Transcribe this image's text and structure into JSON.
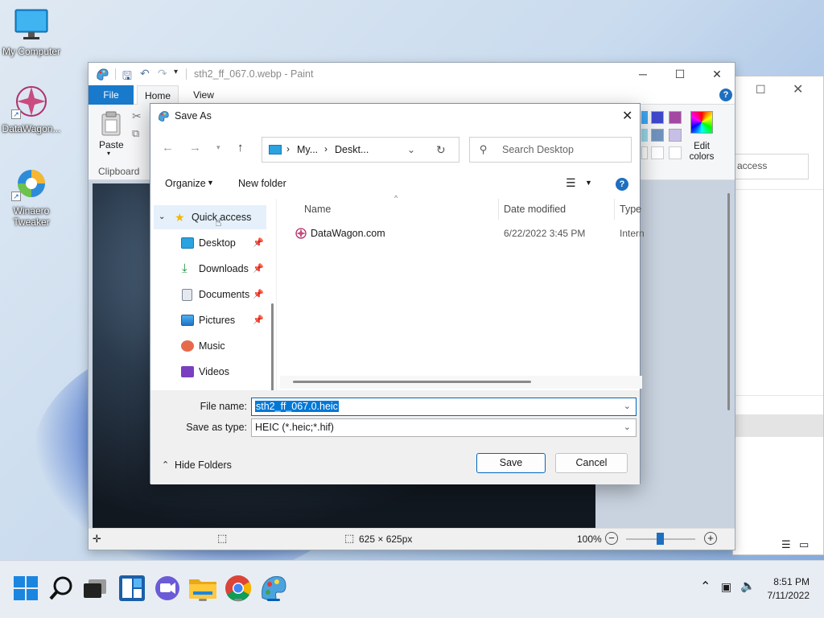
{
  "desktop": {
    "icons": [
      {
        "label": "My Computer"
      },
      {
        "label": "DataWagon..."
      },
      {
        "label": "Winaero Tweaker"
      }
    ]
  },
  "paint": {
    "title": "sth2_ff_067.0.webp - Paint",
    "tabs": [
      "File",
      "Home",
      "View"
    ],
    "ribbon": {
      "paste_label": "Paste",
      "clipboard_label": "Clipboard",
      "edit_colors_label": "Edit colors"
    },
    "status": {
      "image_size": "625 × 625px",
      "zoom": "100%"
    }
  },
  "background_window": {
    "search_fragment": "access"
  },
  "dialog": {
    "title": "Save As",
    "address": {
      "part1": "My...",
      "part2": "Deskt..."
    },
    "search_placeholder": "Search Desktop",
    "organize_label": "Organize",
    "new_folder_label": "New folder",
    "nav": [
      {
        "label": "Quick access",
        "icon": "star-icon"
      },
      {
        "label": "Desktop",
        "icon": "desktop-folder-icon",
        "pinned": true
      },
      {
        "label": "Downloads",
        "icon": "download-icon",
        "pinned": true
      },
      {
        "label": "Documents",
        "icon": "documents-icon",
        "pinned": true
      },
      {
        "label": "Pictures",
        "icon": "pictures-icon",
        "pinned": true
      },
      {
        "label": "Music",
        "icon": "music-icon"
      },
      {
        "label": "Videos",
        "icon": "videos-icon"
      }
    ],
    "columns": [
      "Name",
      "Date modified",
      "Type"
    ],
    "files": [
      {
        "name": "DataWagon.com",
        "date": "6/22/2022 3:45 PM",
        "type": "Intern"
      }
    ],
    "file_name_label": "File name:",
    "file_name_value": "sth2_ff_067.0.heic",
    "save_type_label": "Save as type:",
    "save_type_value": "HEIC (*.heic;*.hif)",
    "hide_folders_label": "Hide Folders",
    "save_label": "Save",
    "cancel_label": "Cancel"
  },
  "taskbar": {
    "time": "8:51 PM",
    "date": "7/11/2022"
  },
  "colors": {
    "accent": "#0067c0",
    "file_tab": "#1979ca",
    "selection": "#0078d7"
  }
}
